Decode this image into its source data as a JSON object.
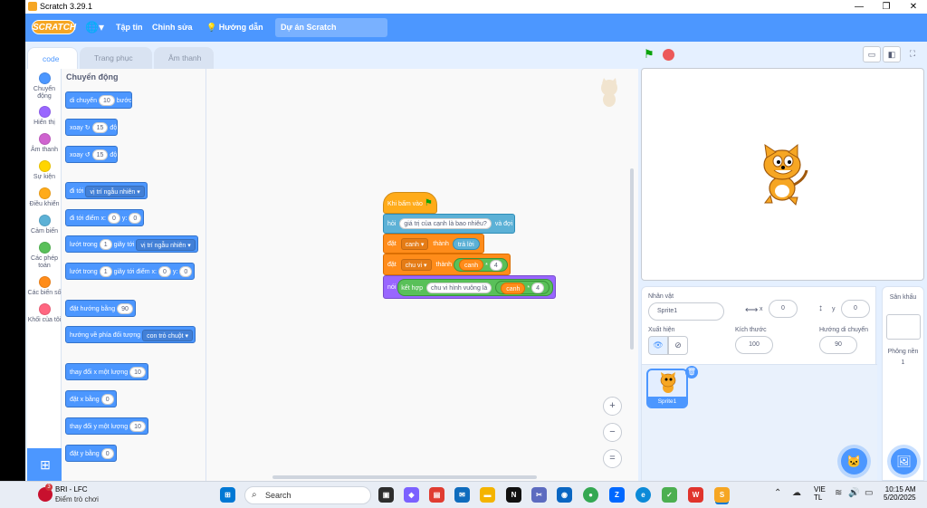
{
  "window": {
    "title": "Scratch 3.29.1"
  },
  "menu": {
    "logo": "SCRATCH",
    "file": "Tập tin",
    "edit": "Chỉnh sửa",
    "tutorials": "Hướng dẫn",
    "project_title": "Dự án Scratch"
  },
  "tabs": {
    "code": "code",
    "costumes": "Trang phục",
    "sounds": "Âm thanh"
  },
  "categories": [
    {
      "label": "Chuyển động",
      "color": "#4c97ff"
    },
    {
      "label": "Hiển thị",
      "color": "#9966ff"
    },
    {
      "label": "Âm thanh",
      "color": "#cf63cf"
    },
    {
      "label": "Sự kiện",
      "color": "#ffd500"
    },
    {
      "label": "Điều khiển",
      "color": "#ffab19"
    },
    {
      "label": "Cảm biến",
      "color": "#5cb1d6"
    },
    {
      "label": "Các phép toán",
      "color": "#59c059"
    },
    {
      "label": "Các biến số",
      "color": "#ff8c1a"
    },
    {
      "label": "Khối của tôi",
      "color": "#ff6680"
    }
  ],
  "palette": {
    "title": "Chuyển động",
    "move": {
      "pre": "di chuyển",
      "val": "10",
      "post": "bước"
    },
    "turn_right": {
      "pre": "xoay",
      "icon": "↻",
      "val": "15",
      "post": "độ"
    },
    "turn_left": {
      "pre": "xoay",
      "icon": "↺",
      "val": "15",
      "post": "độ"
    },
    "goto": {
      "pre": "đi tới",
      "dd": "vị trí ngẫu nhiên"
    },
    "goto_xy": {
      "pre": "đi tới điểm x:",
      "x": "0",
      "mid": "y:",
      "y": "0"
    },
    "glide": {
      "pre": "lướt trong",
      "val": "1",
      "mid": "giây tới",
      "dd": "vị trí ngẫu nhiên"
    },
    "glide_xy": {
      "pre": "lướt trong",
      "val": "1",
      "mid": "giây tới điểm x:",
      "x": "0",
      "mid2": "y:",
      "y": "0"
    },
    "point_dir": {
      "pre": "đặt hướng bằng",
      "val": "90"
    },
    "point_towards": {
      "pre": "hướng về phía đối tượng",
      "dd": "con trỏ chuột"
    },
    "change_x": {
      "pre": "thay đổi x một lượng",
      "val": "10"
    },
    "set_x": {
      "pre": "đặt x bằng",
      "val": "0"
    },
    "change_y": {
      "pre": "thay đổi y một lượng",
      "val": "10"
    },
    "set_y": {
      "pre": "đặt y bằng",
      "val": "0"
    }
  },
  "script": {
    "hat": "Khi bấm vào",
    "ask": {
      "pre": "hỏi",
      "q": "giá trị của cạnh là bao nhiêu?",
      "post": "và đợi"
    },
    "set1": {
      "pre": "đặt",
      "var": "canh",
      "mid": "thành",
      "val": "trả lời"
    },
    "set2": {
      "pre": "đặt",
      "var": "chu vi",
      "mid": "thành",
      "a": "canh",
      "op": "*",
      "b": "4"
    },
    "say": {
      "pre": "nói",
      "join": "kết hợp",
      "text": "chu vi hình vuông là",
      "a": "canh",
      "op": "*",
      "b": "4"
    }
  },
  "zoom": {
    "in": "+",
    "out": "−",
    "reset": "="
  },
  "sprite": {
    "label_name": "Nhân vật",
    "name": "Sprite1",
    "label_x": "x",
    "x": "0",
    "label_y": "y",
    "y": "0",
    "label_show": "Xuất hiện",
    "label_size": "Kích thước",
    "size": "100",
    "label_direction": "Hướng di chuyển",
    "direction": "90",
    "thumb_name": "Sprite1"
  },
  "stage_panel": {
    "title": "Sân khấu",
    "backdrops_label": "Phông nền",
    "backdrops_count": "1"
  },
  "taskbar": {
    "weather_title": "BRI - LFC",
    "weather_sub": "Điểm trò chơi",
    "weather_badge": "3",
    "search": "Search",
    "lang_top": "VIE",
    "lang_bottom": "TL",
    "time": "10:15 AM",
    "date": "5/20/2025"
  }
}
